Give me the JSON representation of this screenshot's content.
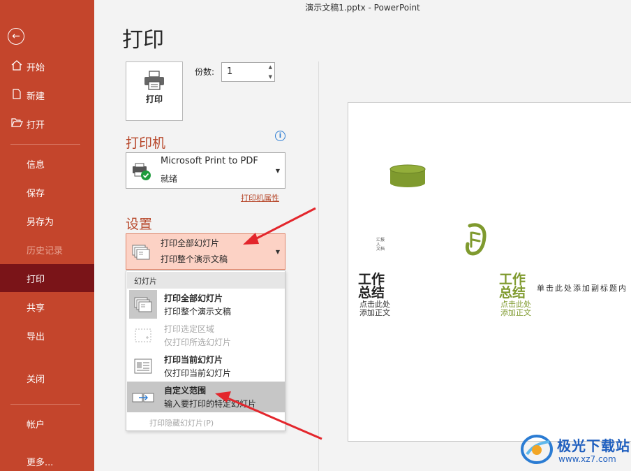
{
  "window": {
    "title": "演示文稿1.pptx  -  PowerPoint"
  },
  "sidebar": {
    "back_icon": "arrow-left-icon",
    "items": [
      {
        "label": "开始",
        "icon": "home-icon"
      },
      {
        "label": "新建",
        "icon": "new-file-icon"
      },
      {
        "label": "打开",
        "icon": "folder-open-icon"
      },
      {
        "label": "信息"
      },
      {
        "label": "保存"
      },
      {
        "label": "另存为"
      },
      {
        "label": "历史记录",
        "disabled": true
      },
      {
        "label": "打印",
        "active": true
      },
      {
        "label": "共享"
      },
      {
        "label": "导出"
      },
      {
        "label": "关闭"
      },
      {
        "label": "帐户"
      },
      {
        "label": "更多..."
      }
    ]
  },
  "colors": {
    "sidebar_bg": "#c4452c",
    "active_bg": "#7a1418",
    "accent": "#b7472a",
    "selected_bg": "#fcd2c5",
    "annotation_arrow": "#e3262c",
    "slide_green": "#7f9a2e"
  },
  "print": {
    "title": "打印",
    "print_button_label": "打印",
    "copies_label": "份数:",
    "copies_value": "1"
  },
  "printer": {
    "section_title": "打印机",
    "name": "Microsoft Print to PDF",
    "status": "就绪",
    "properties_link": "打印机属性"
  },
  "settings": {
    "section_title": "设置",
    "selected_title": "打印全部幻灯片",
    "selected_desc": "打印整个演示文稿",
    "dropdown": {
      "header": "幻灯片",
      "items": [
        {
          "title": "打印全部幻灯片",
          "desc": "打印整个演示文稿"
        },
        {
          "title": "打印选定区域",
          "desc": "仅打印所选幻灯片",
          "disabled": true
        },
        {
          "title": "打印当前幻灯片",
          "desc": "仅打印当前幻灯片"
        },
        {
          "title": "自定义范围",
          "desc": "输入要打印的特定幻灯片",
          "highlighted": true
        }
      ],
      "footer": "打印隐藏幻灯片(P)"
    }
  },
  "preview": {
    "slide_small": "汇报人 文档",
    "title_a": "工作\n总结",
    "sub_a": "点击此处\n添加正文",
    "title_b": "工作\n总结",
    "sub_b": "点击此处\n添加正文",
    "right_text": "单击此处添加副标题内"
  },
  "watermark": {
    "name": "极光下载站",
    "url": "www.xz7.com"
  }
}
